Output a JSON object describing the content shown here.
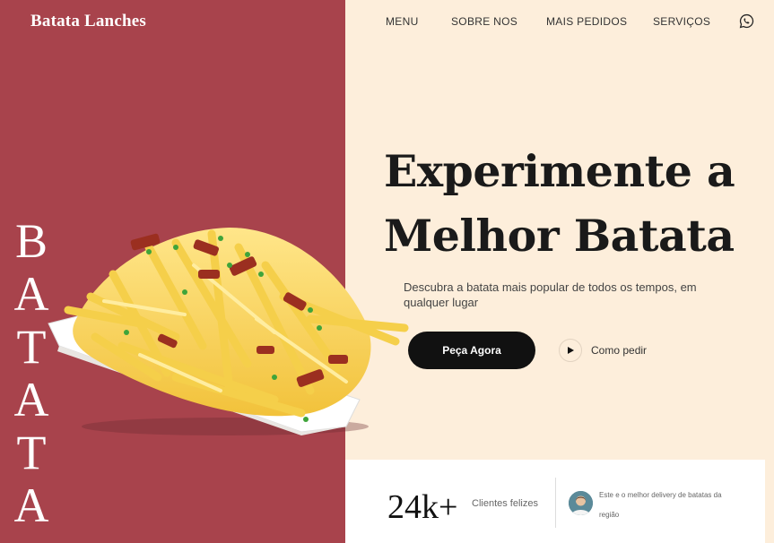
{
  "brand": {
    "name": "Batata Lanches"
  },
  "nav": {
    "items": [
      {
        "label": "MENU"
      },
      {
        "label": "SOBRE NOS"
      },
      {
        "label": "MAIS PEDIDOS"
      },
      {
        "label": "SERVIÇOS"
      }
    ],
    "contact_icon": "whatsapp-icon"
  },
  "hero": {
    "vertical_word": [
      "B",
      "A",
      "T",
      "A",
      "T",
      "A"
    ],
    "headline_line1": "Experimente a",
    "headline_line2": "Melhor Batata",
    "subtitle": "Descubra a batata mais popular de todos os tempos, em qualquer lugar",
    "cta_label": "Peça Agora",
    "secondary_label": "Como pedir",
    "image": "fries-with-bacon-image"
  },
  "stats": {
    "number": "24k+",
    "label": "Clientes felizes",
    "testimonial": "Este e o melhor delivery de batatas da região"
  },
  "colors": {
    "left_panel": "#a8434c",
    "background": "#fdeedb",
    "cta_bg": "#111111",
    "stats_bg": "#ffffff"
  }
}
